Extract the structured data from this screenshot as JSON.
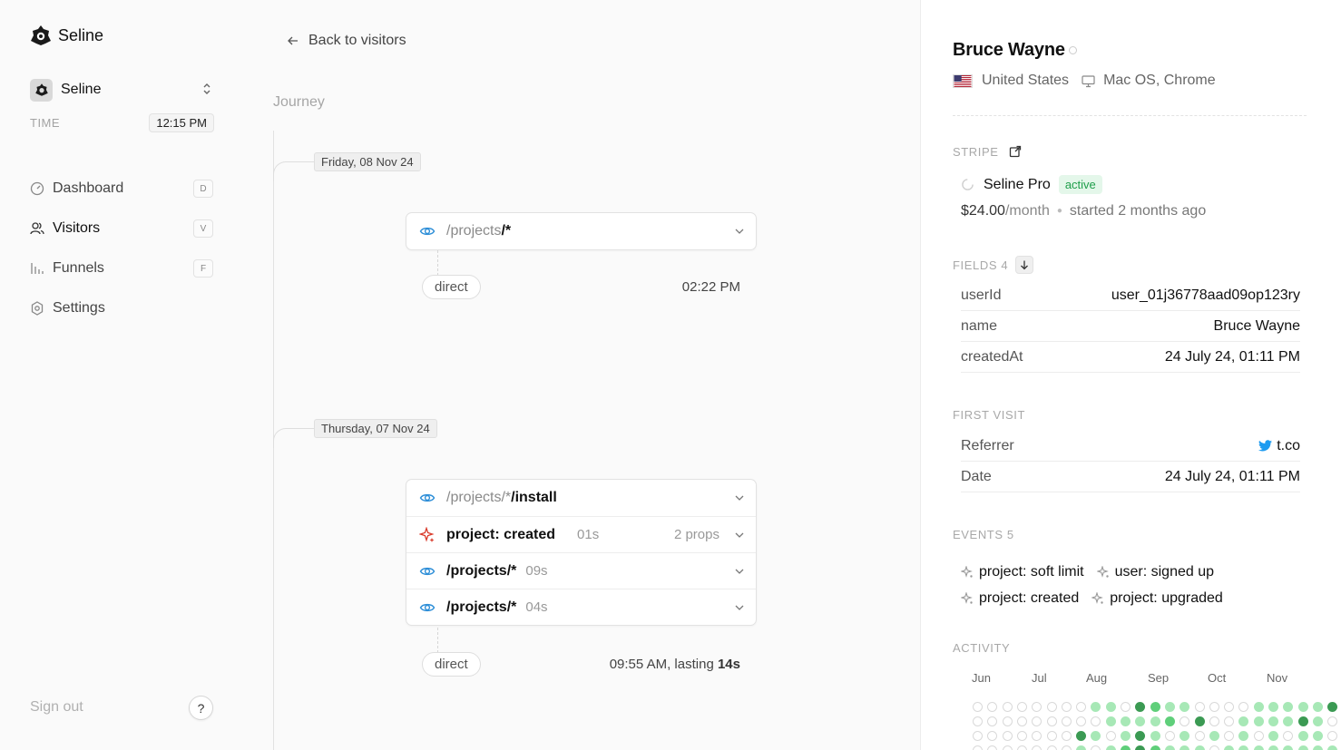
{
  "app": {
    "name": "Seline"
  },
  "workspace": {
    "name": "Seline"
  },
  "time": {
    "label": "TIME",
    "value": "12:15 PM"
  },
  "nav": [
    {
      "label": "Dashboard",
      "key": "D",
      "icon": "dashboard-icon",
      "active": false
    },
    {
      "label": "Visitors",
      "key": "V",
      "icon": "users-icon",
      "active": true
    },
    {
      "label": "Funnels",
      "key": "F",
      "icon": "funnel-icon",
      "active": false
    },
    {
      "label": "Settings",
      "key": "",
      "icon": "settings-icon",
      "active": false
    }
  ],
  "sidebar_footer": {
    "sign_out": "Sign out",
    "help": "?"
  },
  "main": {
    "back_label": "Back to visitors",
    "journey_label": "Journey",
    "sessions": [
      {
        "date": "Friday, 08 Nov 24",
        "rows": [
          {
            "kind": "pageview",
            "dim": "/projects",
            "bold": "/*",
            "duration": "",
            "props": ""
          }
        ],
        "source": "direct",
        "time": "02:22 PM",
        "lasting_prefix": "",
        "lasting": ""
      },
      {
        "date": "Thursday, 07 Nov 24",
        "rows": [
          {
            "kind": "pageview",
            "dim": "/projects/*",
            "bold": "/install",
            "duration": "",
            "props": ""
          },
          {
            "kind": "event",
            "dim": "",
            "bold": "project: created",
            "duration": "01s",
            "props": "2 props"
          },
          {
            "kind": "pageview",
            "dim": "",
            "bold": "/projects/*",
            "duration": "09s",
            "props": ""
          },
          {
            "kind": "pageview",
            "dim": "",
            "bold": "/projects/*",
            "duration": "04s",
            "props": ""
          }
        ],
        "source": "direct",
        "time": "09:55 AM",
        "lasting_prefix": ", lasting ",
        "lasting": "14s"
      }
    ]
  },
  "visitor": {
    "name": "Bruce Wayne",
    "country": "United States",
    "device": "Mac OS, Chrome",
    "stripe": {
      "label": "STRIPE",
      "plan": "Seline Pro",
      "status": "active",
      "price": "$24.00",
      "unit": "/month",
      "started": "started 2 months ago"
    },
    "fields_label": "FIELDS 4",
    "fields": [
      {
        "k": "userId",
        "v": "user_01j36778aad09op123ry"
      },
      {
        "k": "name",
        "v": "Bruce Wayne"
      },
      {
        "k": "createdAt",
        "v": "24 July 24, 01:11 PM"
      }
    ],
    "first_visit_label": "FIRST VISIT",
    "first_visit": [
      {
        "k": "Referrer",
        "v": "t.co"
      },
      {
        "k": "Date",
        "v": "24 July 24, 01:11 PM"
      }
    ],
    "events_label": "EVENTS 5",
    "events": [
      [
        "project: soft limit",
        "user: signed up"
      ],
      [
        "project: created",
        "project: upgraded"
      ]
    ],
    "activity_label": "ACTIVITY",
    "activity_months": [
      "Jun",
      "Jul",
      "Aug",
      "Sep",
      "Oct",
      "Nov"
    ],
    "activity": [
      [
        0,
        0,
        0,
        0,
        0,
        0,
        0,
        0,
        1,
        1,
        0,
        3,
        2,
        1,
        1,
        0,
        0,
        0,
        0,
        1,
        1,
        1,
        1,
        1,
        3
      ],
      [
        0,
        0,
        0,
        0,
        0,
        0,
        0,
        0,
        0,
        1,
        1,
        1,
        1,
        2,
        0,
        3,
        0,
        0,
        1,
        1,
        1,
        1,
        3,
        1,
        0
      ],
      [
        0,
        0,
        0,
        0,
        0,
        0,
        0,
        3,
        1,
        0,
        1,
        3,
        1,
        0,
        1,
        0,
        1,
        0,
        1,
        0,
        1,
        0,
        1,
        1,
        0
      ],
      [
        0,
        0,
        0,
        0,
        0,
        0,
        0,
        1,
        0,
        1,
        2,
        3,
        2,
        1,
        1,
        1,
        0,
        1,
        1,
        1,
        1,
        1,
        1,
        1,
        1
      ]
    ],
    "colors": {
      "level0": "#ffffff",
      "level1": "#a7e8b6",
      "level2": "#5fcf7a",
      "level3": "#3b9a53",
      "accent": "#1e9e4a"
    }
  }
}
